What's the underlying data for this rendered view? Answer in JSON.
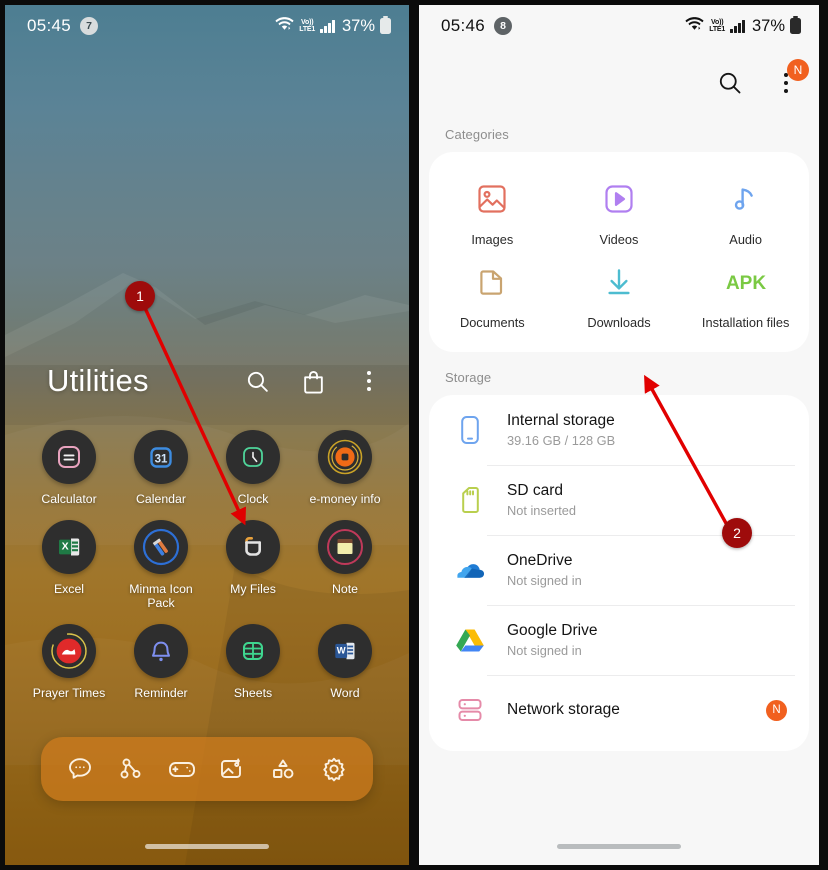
{
  "left_phone": {
    "status_bar": {
      "time": "05:45",
      "notification_count": "7",
      "battery_percent": "37%",
      "network_label": "Vo))",
      "network_type": "LTE1"
    },
    "drawer": {
      "title": "Utilities",
      "actions": [
        {
          "name": "search-icon",
          "label": "Search"
        },
        {
          "name": "shop-icon",
          "label": "Galaxy Store"
        },
        {
          "name": "more-options-icon",
          "label": "More options"
        }
      ]
    },
    "apps": [
      {
        "label": "Calculator",
        "icon": "calculator-icon"
      },
      {
        "label": "Calendar",
        "icon": "calendar-icon"
      },
      {
        "label": "Clock",
        "icon": "clock-icon"
      },
      {
        "label": "e-money info",
        "icon": "emoney-icon"
      },
      {
        "label": "Excel",
        "icon": "excel-icon"
      },
      {
        "label": "Minma Icon Pack",
        "icon": "minma-icon-pack-icon"
      },
      {
        "label": "My Files",
        "icon": "my-files-icon"
      },
      {
        "label": "Note",
        "icon": "note-icon"
      },
      {
        "label": "Prayer Times",
        "icon": "prayer-times-icon"
      },
      {
        "label": "Reminder",
        "icon": "reminder-icon"
      },
      {
        "label": "Sheets",
        "icon": "sheets-icon"
      },
      {
        "label": "Word",
        "icon": "word-icon"
      }
    ],
    "dock": [
      {
        "icon": "messages-icon",
        "label": "Messages"
      },
      {
        "icon": "share-icon",
        "label": "Quick Share"
      },
      {
        "icon": "gamepad-icon",
        "label": "Game Launcher"
      },
      {
        "icon": "media-icon",
        "label": "Gallery Media"
      },
      {
        "icon": "shapes-icon",
        "label": "Utilities"
      },
      {
        "icon": "gear-icon",
        "label": "Settings"
      }
    ]
  },
  "right_phone": {
    "status_bar": {
      "time": "05:46",
      "notification_count": "8",
      "battery_percent": "37%",
      "network_label": "Vo))",
      "network_type": "LTE1"
    },
    "app_bar": {
      "search_icon": "search-icon",
      "more_icon": "more-options-icon",
      "account_badge": "N"
    },
    "categories": {
      "section_label": "Categories",
      "items": [
        {
          "label": "Images",
          "icon": "image-icon",
          "color": "#e2705f"
        },
        {
          "label": "Videos",
          "icon": "video-icon",
          "color": "#b07ff0"
        },
        {
          "label": "Audio",
          "icon": "audio-icon",
          "color": "#6ea4ee"
        },
        {
          "label": "Documents",
          "icon": "document-icon",
          "color": "#c9a470"
        },
        {
          "label": "Downloads",
          "icon": "download-icon",
          "color": "#4dbcd0"
        },
        {
          "label": "Installation files",
          "icon": "apk-icon",
          "color": "#7ac943"
        }
      ]
    },
    "storage": {
      "section_label": "Storage",
      "items": [
        {
          "title": "Internal storage",
          "subtitle": "39.16 GB / 128 GB",
          "icon": "phone-storage-icon",
          "badge": ""
        },
        {
          "title": "SD card",
          "subtitle": "Not inserted",
          "icon": "sd-card-icon",
          "badge": ""
        },
        {
          "title": "OneDrive",
          "subtitle": "Not signed in",
          "icon": "onedrive-icon",
          "badge": ""
        },
        {
          "title": "Google Drive",
          "subtitle": "Not signed in",
          "icon": "google-drive-icon",
          "badge": ""
        },
        {
          "title": "Network storage",
          "subtitle": "",
          "icon": "network-storage-icon",
          "badge": "N"
        }
      ]
    }
  },
  "annotations": {
    "accent_color": "#e10000",
    "marker_color": "#9e0b0b",
    "markers": [
      {
        "number": "1",
        "points_to": "My Files"
      },
      {
        "number": "2",
        "points_to": "Downloads"
      }
    ]
  }
}
